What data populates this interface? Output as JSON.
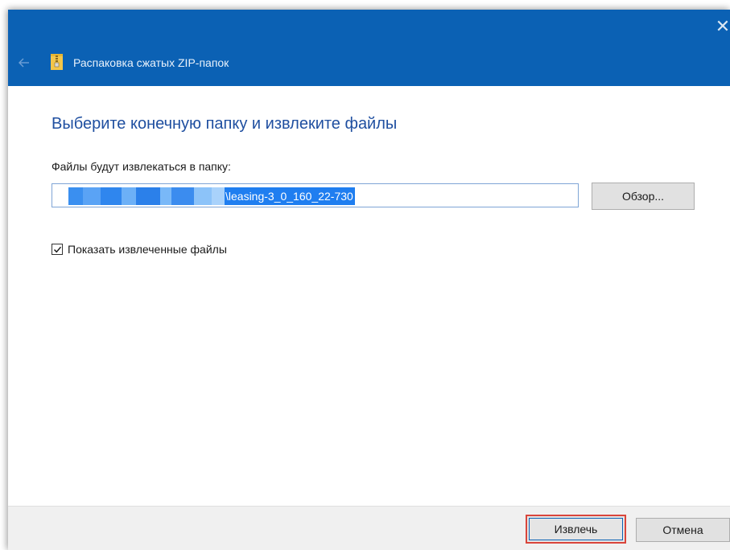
{
  "window": {
    "title": "Распаковка сжатых ZIP-папок",
    "close_glyph": "✕"
  },
  "main": {
    "heading": "Выберите конечную папку и извлеките файлы",
    "folder_label": "Файлы будут извлекаться в папку:",
    "path_value_visible": "\\leasing-3_0_160_22-730",
    "browse_label": "Обзор...",
    "show_files_label": "Показать извлеченные файлы",
    "show_files_checked": true
  },
  "footer": {
    "extract_label": "Извлечь",
    "cancel_label": "Отмена"
  },
  "icons": {
    "back": "arrow-left-icon",
    "zip": "zip-folder-icon",
    "close": "close-icon",
    "check": "checkmark-icon"
  },
  "colors": {
    "titlebar": "#0b61b4",
    "heading": "#1f4fa0",
    "selection": "#1f7ef0",
    "highlight_border": "#d9453b"
  }
}
